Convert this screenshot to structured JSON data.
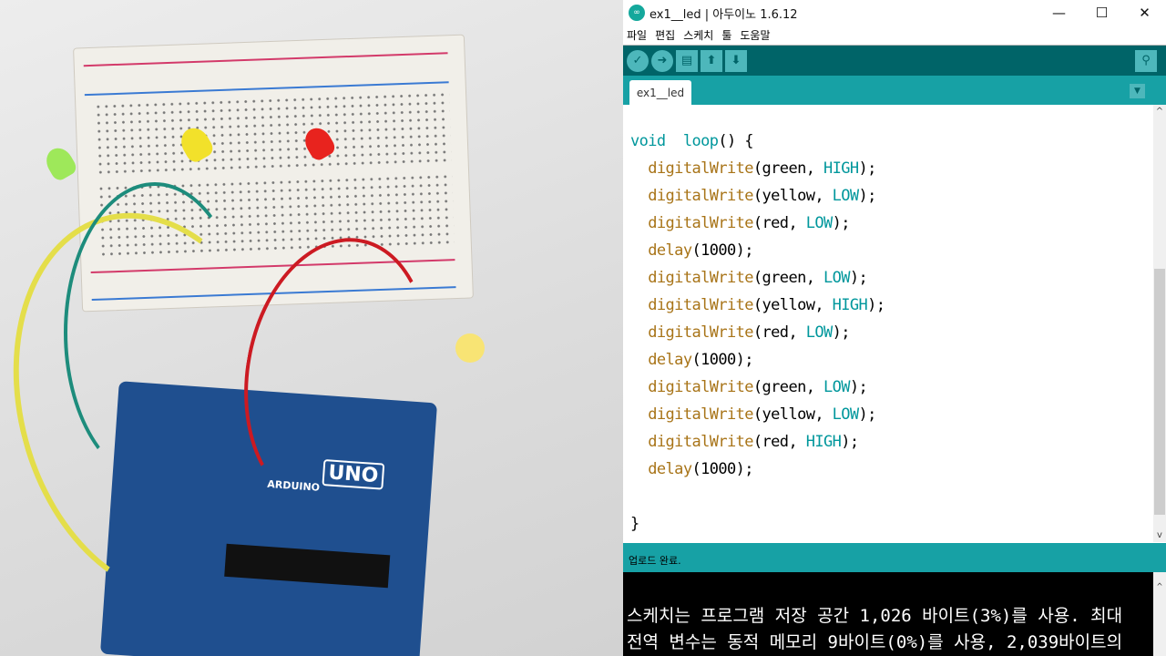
{
  "window": {
    "title": "ex1__led | 아두이노 1.6.12",
    "logo": "∞",
    "minimize": "—",
    "maximize": "☐",
    "close": "✕"
  },
  "menu": [
    "파일",
    "편집",
    "스케치",
    "툴",
    "도움말"
  ],
  "toolbar": {
    "verify": "✓",
    "upload": "➜",
    "new": "▤",
    "open": "⬆",
    "save": "⬇",
    "serial_monitor": "⚲"
  },
  "tabs": [
    {
      "label": "ex1__led"
    }
  ],
  "tab_menu": "▼",
  "code_lines": [
    [
      [
        "kw",
        "void"
      ],
      [
        "",
        "  "
      ],
      [
        "kw",
        "loop"
      ],
      [
        "",
        "() {"
      ]
    ],
    [
      [
        "",
        "  "
      ],
      [
        "fn",
        "digitalWrite"
      ],
      [
        "",
        "(green, "
      ],
      [
        "cn",
        "HIGH"
      ],
      [
        "",
        ");"
      ]
    ],
    [
      [
        "",
        "  "
      ],
      [
        "fn",
        "digitalWrite"
      ],
      [
        "",
        "(yellow, "
      ],
      [
        "cn",
        "LOW"
      ],
      [
        "",
        ");"
      ]
    ],
    [
      [
        "",
        "  "
      ],
      [
        "fn",
        "digitalWrite"
      ],
      [
        "",
        "(red, "
      ],
      [
        "cn",
        "LOW"
      ],
      [
        "",
        ");"
      ]
    ],
    [
      [
        "",
        "  "
      ],
      [
        "fn",
        "delay"
      ],
      [
        "",
        "(1000);"
      ]
    ],
    [
      [
        "",
        "  "
      ],
      [
        "fn",
        "digitalWrite"
      ],
      [
        "",
        "(green, "
      ],
      [
        "cn",
        "LOW"
      ],
      [
        "",
        ");"
      ]
    ],
    [
      [
        "",
        "  "
      ],
      [
        "fn",
        "digitalWrite"
      ],
      [
        "",
        "(yellow, "
      ],
      [
        "cn",
        "HIGH"
      ],
      [
        "",
        ");"
      ]
    ],
    [
      [
        "",
        "  "
      ],
      [
        "fn",
        "digitalWrite"
      ],
      [
        "",
        "(red, "
      ],
      [
        "cn",
        "LOW"
      ],
      [
        "",
        ");"
      ]
    ],
    [
      [
        "",
        "  "
      ],
      [
        "fn",
        "delay"
      ],
      [
        "",
        "(1000);"
      ]
    ],
    [
      [
        "",
        "  "
      ],
      [
        "fn",
        "digitalWrite"
      ],
      [
        "",
        "(green, "
      ],
      [
        "cn",
        "LOW"
      ],
      [
        "",
        ");"
      ]
    ],
    [
      [
        "",
        "  "
      ],
      [
        "fn",
        "digitalWrite"
      ],
      [
        "",
        "(yellow, "
      ],
      [
        "cn",
        "LOW"
      ],
      [
        "",
        ");"
      ]
    ],
    [
      [
        "",
        "  "
      ],
      [
        "fn",
        "digitalWrite"
      ],
      [
        "",
        "(red, "
      ],
      [
        "cn",
        "HIGH"
      ],
      [
        "",
        ");"
      ]
    ],
    [
      [
        "",
        "  "
      ],
      [
        "fn",
        "delay"
      ],
      [
        "",
        "(1000);"
      ]
    ],
    [
      [
        "",
        ""
      ]
    ],
    [
      [
        "",
        "}"
      ]
    ]
  ],
  "status": "업로드 완료.",
  "console": [
    "스케치는 프로그램 저장 공간 1,026 바이트(3%)를 사용. 최대",
    "전역 변수는 동적 메모리 9바이트(0%)를 사용, 2,039바이트의"
  ],
  "photo": {
    "board_label": "UNO",
    "brand": "ARDUINO",
    "leds": [
      "green",
      "yellow",
      "red"
    ]
  }
}
